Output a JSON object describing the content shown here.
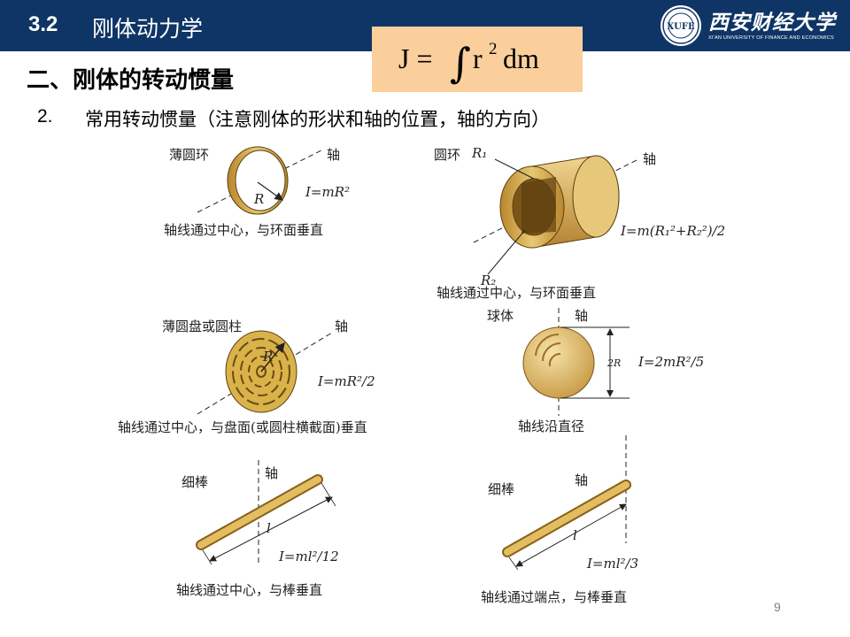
{
  "header": {
    "section_number": "3.2",
    "section_title": "刚体动力学",
    "university_cn": "西安财经大学",
    "university_en": "XI'AN UNIVERSITY OF FINANCE AND ECONOMICS",
    "logo_text": "XUFE"
  },
  "formula": {
    "lhs": "J =",
    "integral": "∫",
    "r": "r",
    "exp": "2",
    "dm": "dm"
  },
  "subheading": "二、刚体的转动惯量",
  "item": {
    "number": "2.",
    "text": "常用转动惯量（注意刚体的形状和轴的位置，轴的方向）"
  },
  "figure": {
    "thin_ring": {
      "name": "薄圆环",
      "axis": "轴",
      "radius": "R",
      "formula": "I=mR²",
      "caption": "轴线通过中心，与环面垂直"
    },
    "annulus": {
      "name": "圆环",
      "r1": "R₁",
      "r2": "R₂",
      "axis": "轴",
      "formula": "I=m(R₁²+R₂²)/2",
      "caption": "轴线通过中心，与环面垂直"
    },
    "disk": {
      "name": "薄圆盘或圆柱",
      "axis": "轴",
      "radius": "R",
      "formula": "I=mR²/2",
      "caption": "轴线通过中心，与盘面(或圆柱横截面)垂直"
    },
    "sphere": {
      "name": "球体",
      "axis": "轴",
      "diameter": "2R",
      "formula": "I=2mR²/5",
      "caption": "轴线沿直径"
    },
    "rod_center": {
      "name": "细棒",
      "axis": "轴",
      "length": "l",
      "formula": "I=ml²/12",
      "caption": "轴线通过中心，与棒垂直"
    },
    "rod_end": {
      "name": "细棒",
      "axis": "轴",
      "length": "l",
      "formula": "I=ml²/3",
      "caption": "轴线通过端点，与棒垂直"
    }
  },
  "page_number": "9",
  "colors": {
    "header_bg": "#0f3566",
    "formula_bg": "#fbcf9b",
    "wood": "#d9b24a"
  }
}
